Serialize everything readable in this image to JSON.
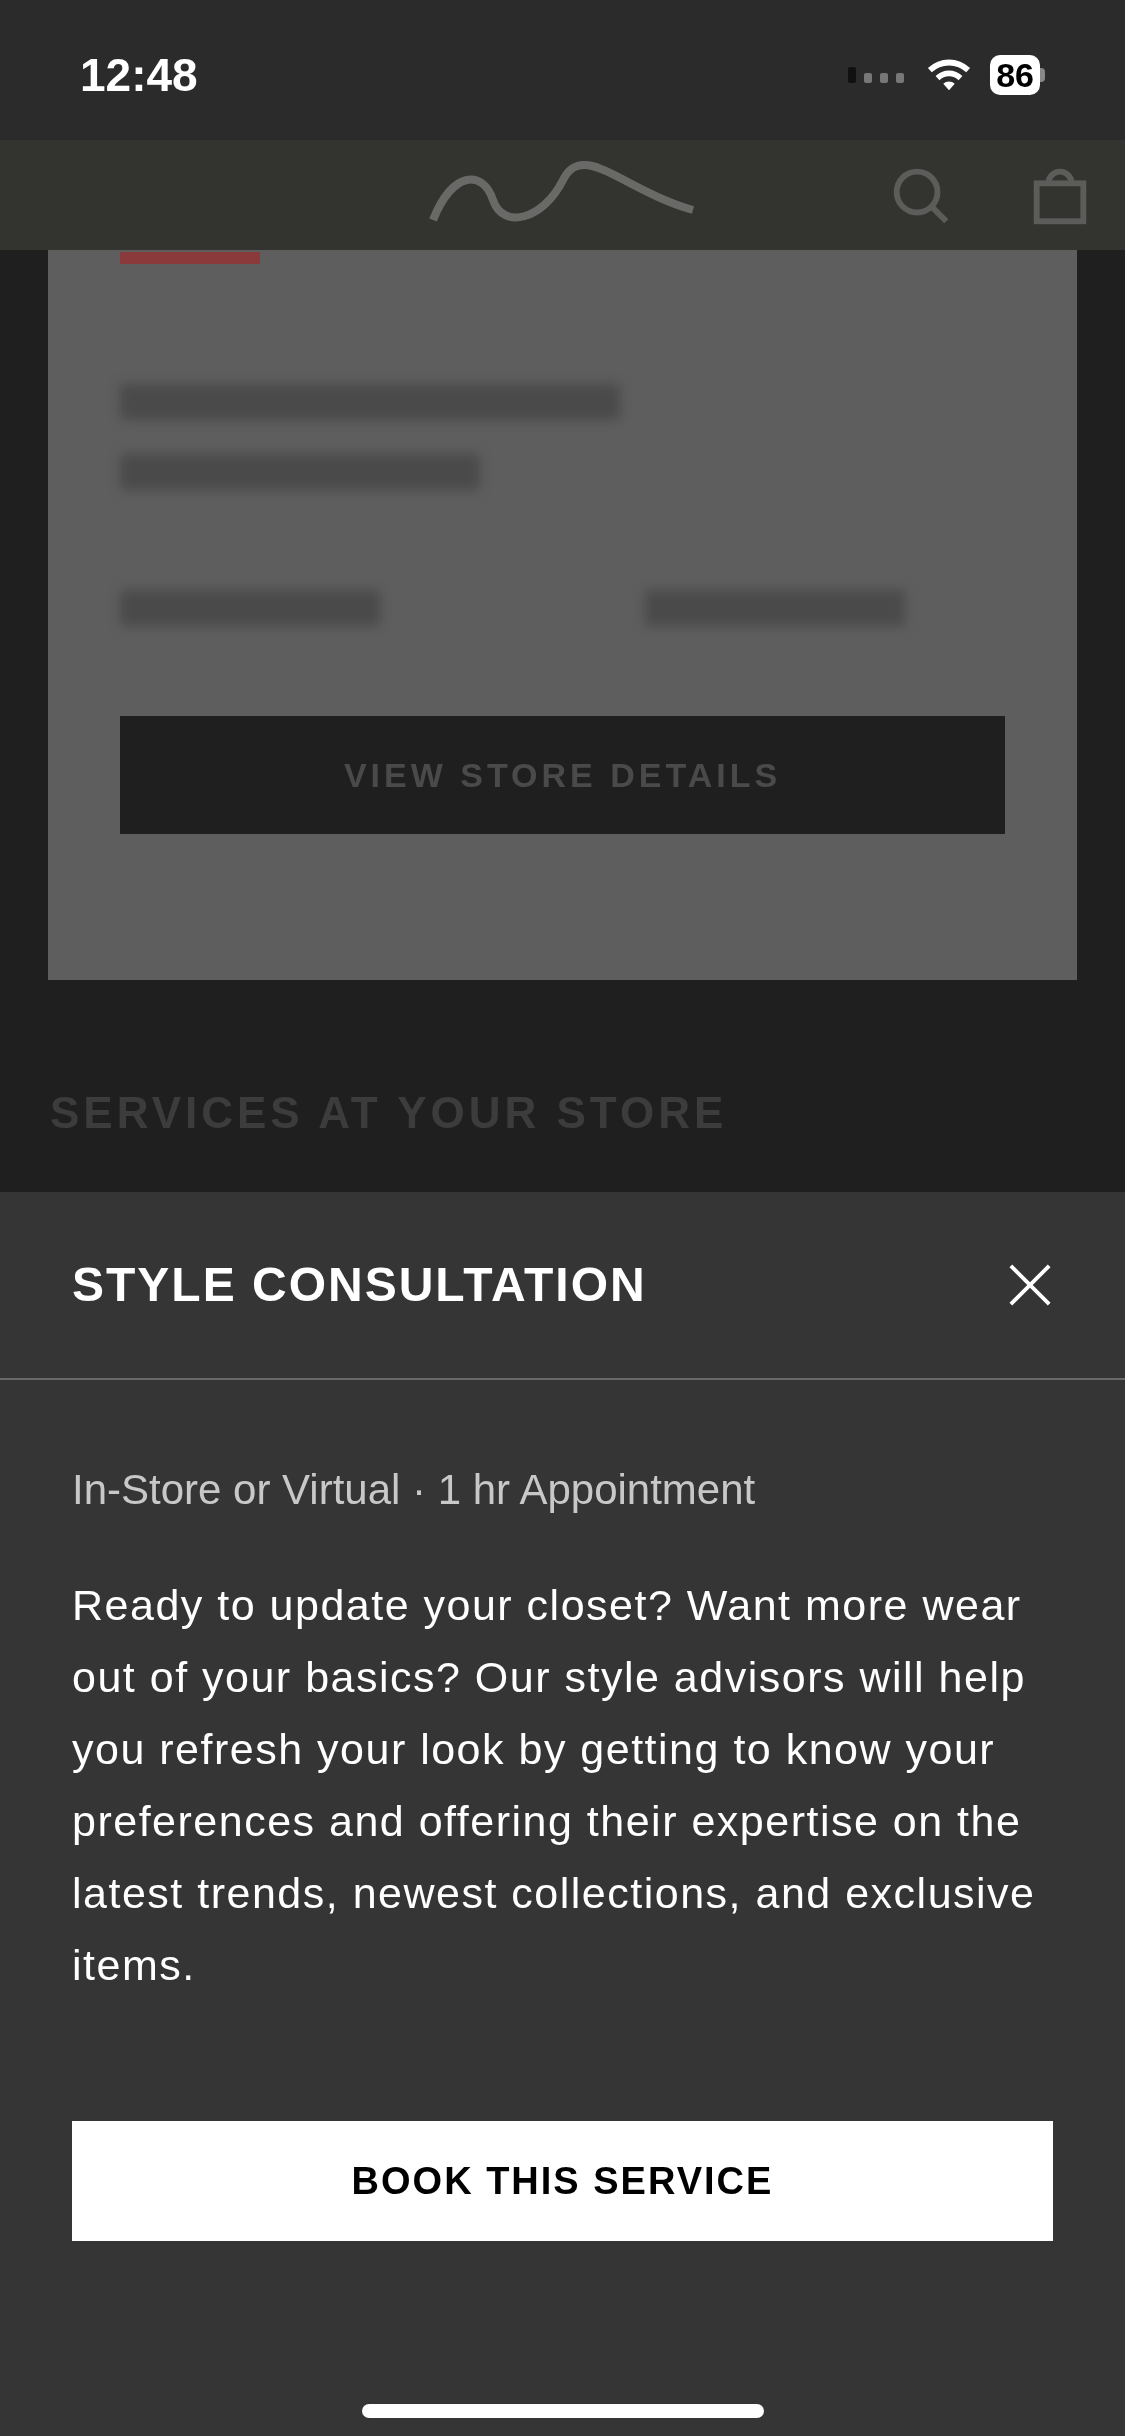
{
  "status_bar": {
    "time": "12:48",
    "battery": "86"
  },
  "background": {
    "button": "VIEW STORE DETAILS",
    "section_title": "SERVICES AT YOUR STORE"
  },
  "sheet": {
    "title": "STYLE CONSULTATION",
    "subtitle": "In-Store or Virtual · 1 hr Appointment",
    "description": "Ready to update your closet? Want more wear out of your basics? Our style advisors will help you refresh your look by getting to know your preferences and offering their expertise on the latest trends, newest collections, and exclusive items.",
    "button": "BOOK THIS SERVICE"
  }
}
